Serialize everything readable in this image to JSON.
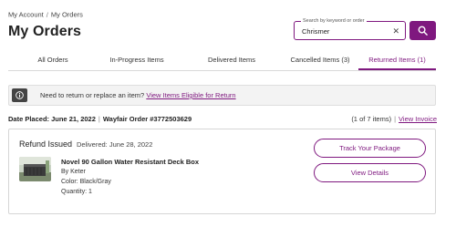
{
  "breadcrumb": {
    "items": [
      "My Account",
      "My Orders"
    ],
    "separator": "/"
  },
  "page": {
    "title": "My Orders"
  },
  "search": {
    "legend": "Search by keyword or order",
    "value": "Chrismer",
    "clear_icon": "close-icon",
    "button_icon": "search-icon"
  },
  "tabs": [
    {
      "label": "All Orders",
      "active": false
    },
    {
      "label": "In-Progress Items",
      "active": false
    },
    {
      "label": "Delivered Items",
      "active": false
    },
    {
      "label": "Cancelled Items (3)",
      "active": false
    },
    {
      "label": "Returned Items (1)",
      "active": true
    }
  ],
  "notice": {
    "text": "Need to return or replace an item?",
    "link": "View Items Eligible for Return",
    "icon": "info-icon"
  },
  "order": {
    "date_placed": "Date Placed: June 21, 2022",
    "order_number": "Wayfair Order #3772503629",
    "item_count": "(1 of 7 items)",
    "invoice_link": "View Invoice"
  },
  "item": {
    "status": "Refund Issued",
    "delivered": "Delivered: June 28, 2022",
    "name": "Novel 90 Gallon Water Resistant Deck Box",
    "brand": "By Keter",
    "color": "Color: Black/Gray",
    "quantity": "Quantity: 1",
    "track_button": "Track Your Package",
    "details_button": "View Details"
  },
  "colors": {
    "accent": "#7f187f",
    "notice_bg": "#f3f3f3"
  }
}
